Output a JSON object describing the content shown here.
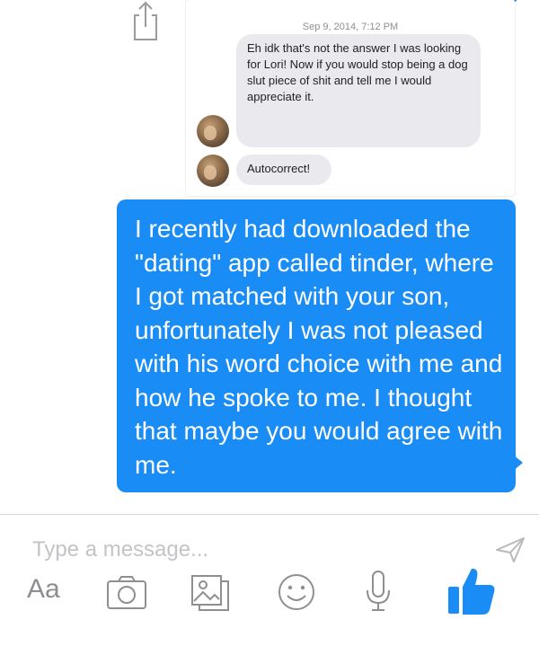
{
  "conversation": {
    "timestamp": "Sep 9, 2014, 7:12 PM",
    "incoming_messages": [
      {
        "text": "Eh idk that's not the answer I was looking for Lori! Now if you would stop being a dog slut piece of shit and tell me I would appreciate it."
      },
      {
        "text": "Autocorrect!"
      }
    ],
    "outgoing_message": {
      "text": "I recently had downloaded the \"dating\" app called tinder, where I got matched with your son, unfortunately I was not pleased with his word choice with me and how he spoke to me. I thought that maybe you would agree with me."
    }
  },
  "composer": {
    "placeholder": "Type a message...",
    "toolbar": {
      "text_format_label": "Aa",
      "icons": [
        "camera-icon",
        "photo-gallery-icon",
        "emoji-icon",
        "microphone-icon",
        "thumbs-up-icon"
      ]
    }
  },
  "colors": {
    "accent": "#1a8cf5",
    "incoming_bubble": "#e9e9ee",
    "icon_gray": "#8e8e93"
  }
}
